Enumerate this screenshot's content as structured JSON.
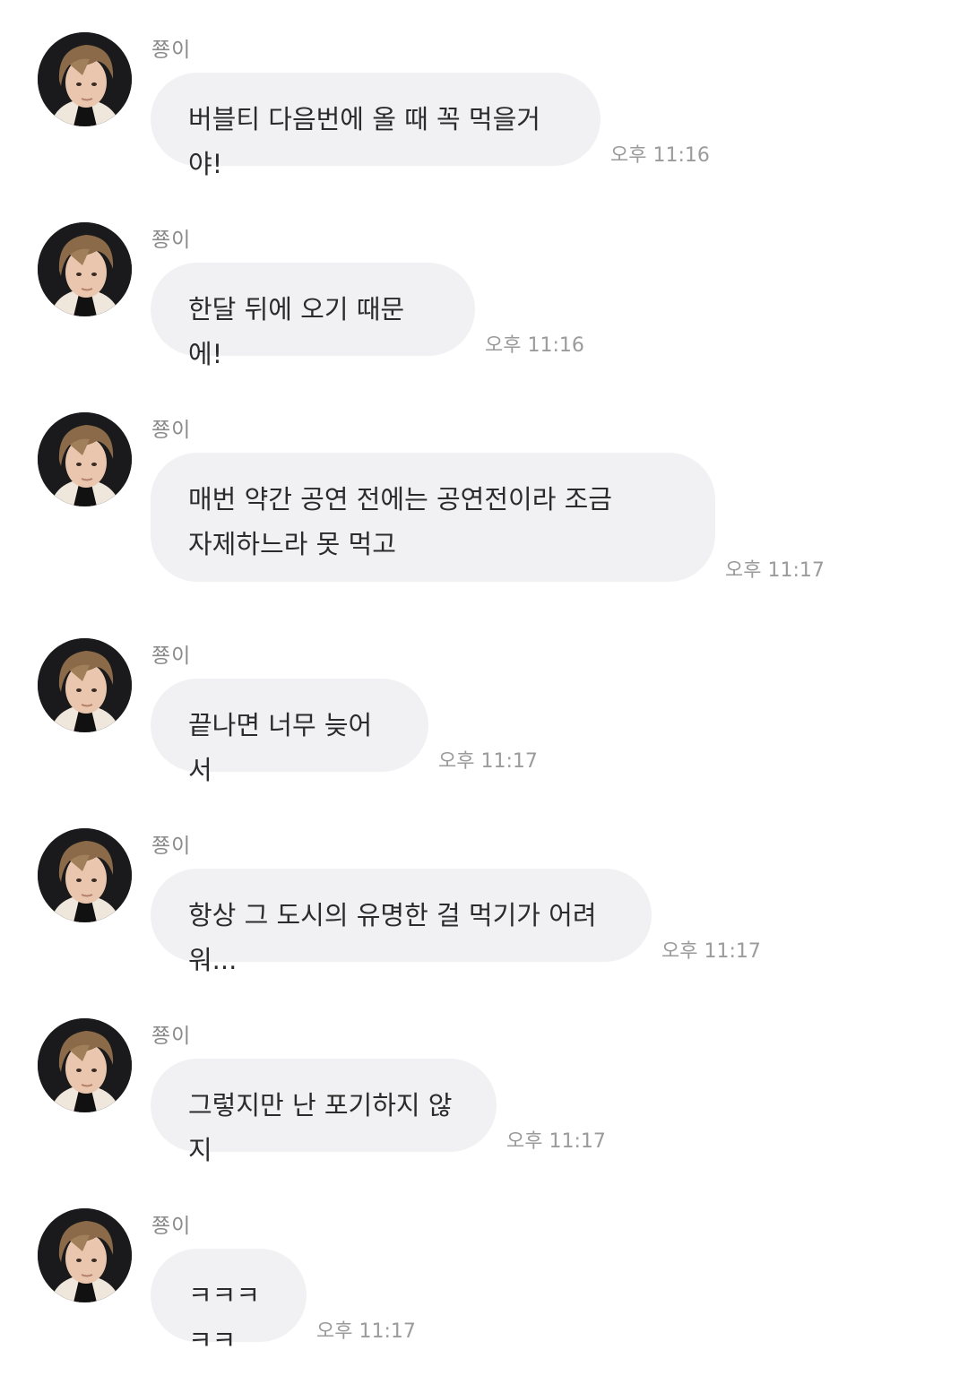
{
  "messages": [
    {
      "sender": "쭁이",
      "text": "버블티 다음번에 올 때 꼭 먹을거야!",
      "time": "오후 11:16"
    },
    {
      "sender": "쭁이",
      "text": "한달 뒤에 오기 때문에!",
      "time": "오후 11:16"
    },
    {
      "sender": "쭁이",
      "text": "매번 약간 공연 전에는 공연전이라 조금\n자제하느라 못 먹고",
      "time": "오후 11:17"
    },
    {
      "sender": "쭁이",
      "text": "끝나면 너무 늦어서",
      "time": "오후 11:17"
    },
    {
      "sender": "쭁이",
      "text": "항상 그 도시의 유명한 걸 먹기가 어려워...",
      "time": "오후 11:17"
    },
    {
      "sender": "쭁이",
      "text": "그렇지만 난 포기하지 않지",
      "time": "오후 11:17"
    },
    {
      "sender": "쭁이",
      "text": "ㅋㅋㅋㅋㅋ",
      "time": "오후 11:17"
    }
  ]
}
